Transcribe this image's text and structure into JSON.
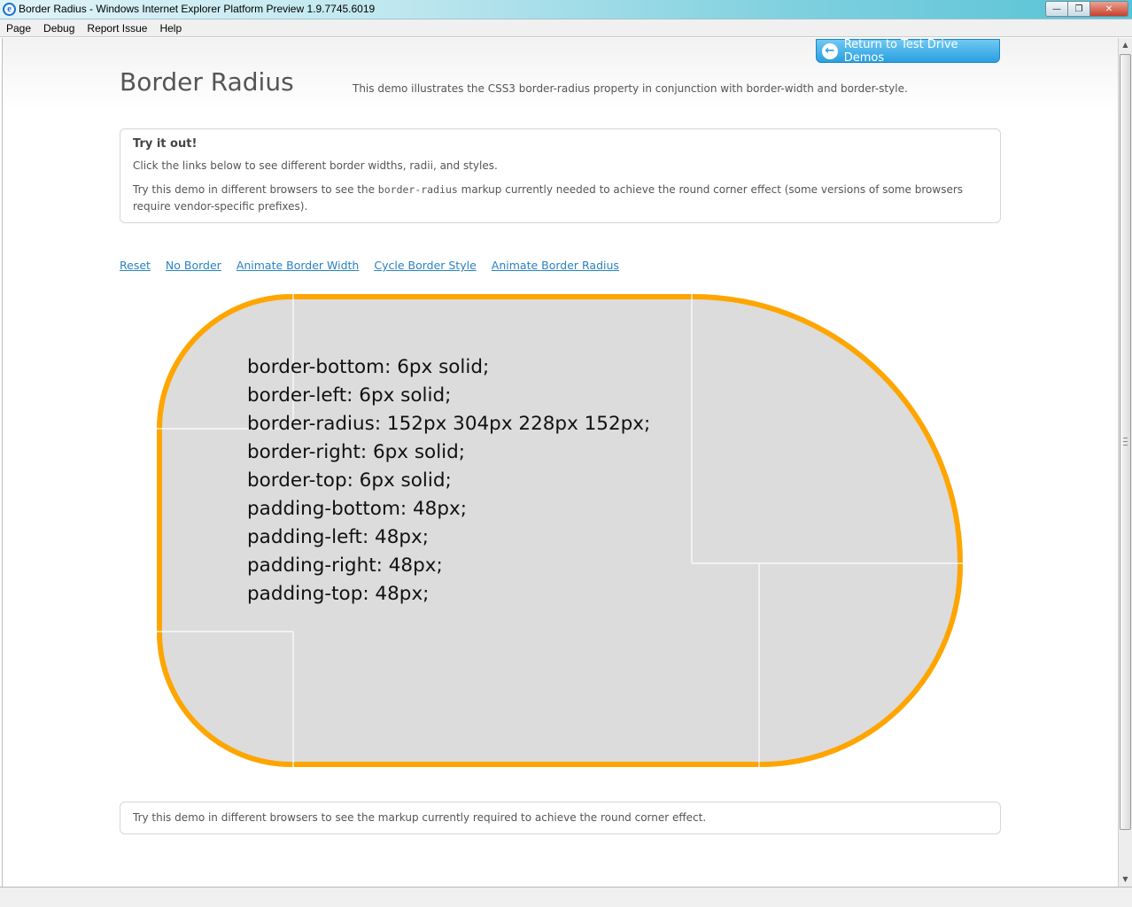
{
  "window": {
    "title": "Border Radius - Windows Internet Explorer Platform Preview 1.9.7745.6019",
    "minimize_label": "—",
    "maximize_label": "❐",
    "close_label": "✕"
  },
  "menu": [
    "Page",
    "Debug",
    "Report Issue",
    "Help"
  ],
  "header": {
    "return_label": "Return to Test Drive Demos",
    "title": "Border Radius",
    "description": "This demo illustrates the CSS3 border-radius property in conjunction with border-width and border-style."
  },
  "tryit": {
    "title": "Try it out!",
    "p1": "Click the links below to see different border widths, radii, and styles.",
    "p2_before": "Try this demo in different browsers to see the ",
    "p2_code": "border-radius",
    "p2_after": " markup currently needed to achieve the round corner effect (some versions of some browsers require vendor-specific prefixes)."
  },
  "links": [
    "Reset",
    "No Border",
    "Animate Border Width",
    "Cycle Border Style",
    "Animate Border Radius"
  ],
  "demo": {
    "border_color": "#ffa500",
    "background_color": "#dcdcdc",
    "lines": [
      "border-bottom: 6px solid;",
      "border-left: 6px solid;",
      "border-radius: 152px 304px 228px 152px;",
      "border-right: 6px solid;",
      "border-top: 6px solid;",
      "padding-bottom: 48px;",
      "padding-left: 48px;",
      "padding-right: 48px;",
      "padding-top: 48px;"
    ]
  },
  "footer": {
    "text": "Try this demo in different browsers to see the markup currently required to achieve the round corner effect."
  }
}
